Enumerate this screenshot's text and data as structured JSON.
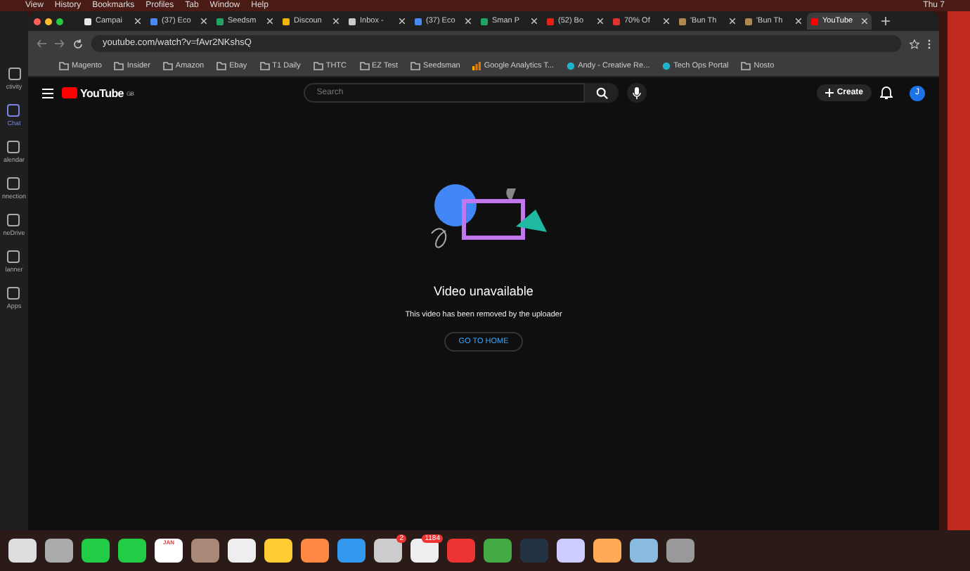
{
  "menu_bar": {
    "items": [
      "View",
      "History",
      "Bookmarks",
      "Profiles",
      "Tab",
      "Window",
      "Help"
    ],
    "clock": "Thu 7"
  },
  "tabs": [
    {
      "label": "Campai",
      "color": "#e8e8e8",
      "selected": false
    },
    {
      "label": "(37) Eco",
      "color": "#4a8af4",
      "selected": false
    },
    {
      "label": "Seedsm",
      "color": "#1fa463",
      "selected": false
    },
    {
      "label": "Discoun",
      "color": "#f4b400",
      "selected": false
    },
    {
      "label": "Inbox -",
      "color": "#cccccc",
      "selected": false
    },
    {
      "label": "(37) Eco",
      "color": "#4a8af4",
      "selected": false
    },
    {
      "label": "Sman P",
      "color": "#1fa463",
      "selected": false
    },
    {
      "label": "(52) Bo",
      "color": "#e62117",
      "selected": false
    },
    {
      "label": "70% Of",
      "color": "#e03030",
      "selected": false
    },
    {
      "label": "'Bun Th",
      "color": "#b08850",
      "selected": false
    },
    {
      "label": "'Bun Th",
      "color": "#b08850",
      "selected": false
    },
    {
      "label": "YouTube",
      "color": "#ff0000",
      "selected": true
    }
  ],
  "address_bar": {
    "url": "youtube.com/watch?v=fAvr2NKshsQ"
  },
  "bookmarks": [
    {
      "label": "Magento",
      "kind": "folder"
    },
    {
      "label": "Insider",
      "kind": "folder"
    },
    {
      "label": "Amazon",
      "kind": "folder"
    },
    {
      "label": "Ebay",
      "kind": "folder"
    },
    {
      "label": "T1 Daily",
      "kind": "folder"
    },
    {
      "label": "THTC",
      "kind": "folder"
    },
    {
      "label": "EZ Test",
      "kind": "folder"
    },
    {
      "label": "Seedsman",
      "kind": "folder"
    },
    {
      "label": "Google Analytics T...",
      "kind": "analytics"
    },
    {
      "label": "Andy - Creative Re...",
      "kind": "site"
    },
    {
      "label": "Tech Ops Portal",
      "kind": "site"
    },
    {
      "label": "Nosto",
      "kind": "folder"
    }
  ],
  "teams_sidebar": [
    {
      "label": "ctivity",
      "selected": false
    },
    {
      "label": "Chat",
      "selected": true
    },
    {
      "label": "alendar",
      "selected": false
    },
    {
      "label": "nnection",
      "selected": false
    },
    {
      "label": "neDrive",
      "selected": false
    },
    {
      "label": "lanner",
      "selected": false
    },
    {
      "label": "Apps",
      "selected": false
    }
  ],
  "youtube": {
    "logo": "YouTube",
    "region": "GB",
    "search_placeholder": "Search",
    "create": "Create",
    "avatar": "J"
  },
  "message": {
    "title": "Video unavailable",
    "subtitle": "This video has been removed by the uploader",
    "button": "GO TO HOME"
  },
  "dock": {
    "calendar_month": "JAN",
    "badges": [
      "2",
      "1184"
    ]
  }
}
